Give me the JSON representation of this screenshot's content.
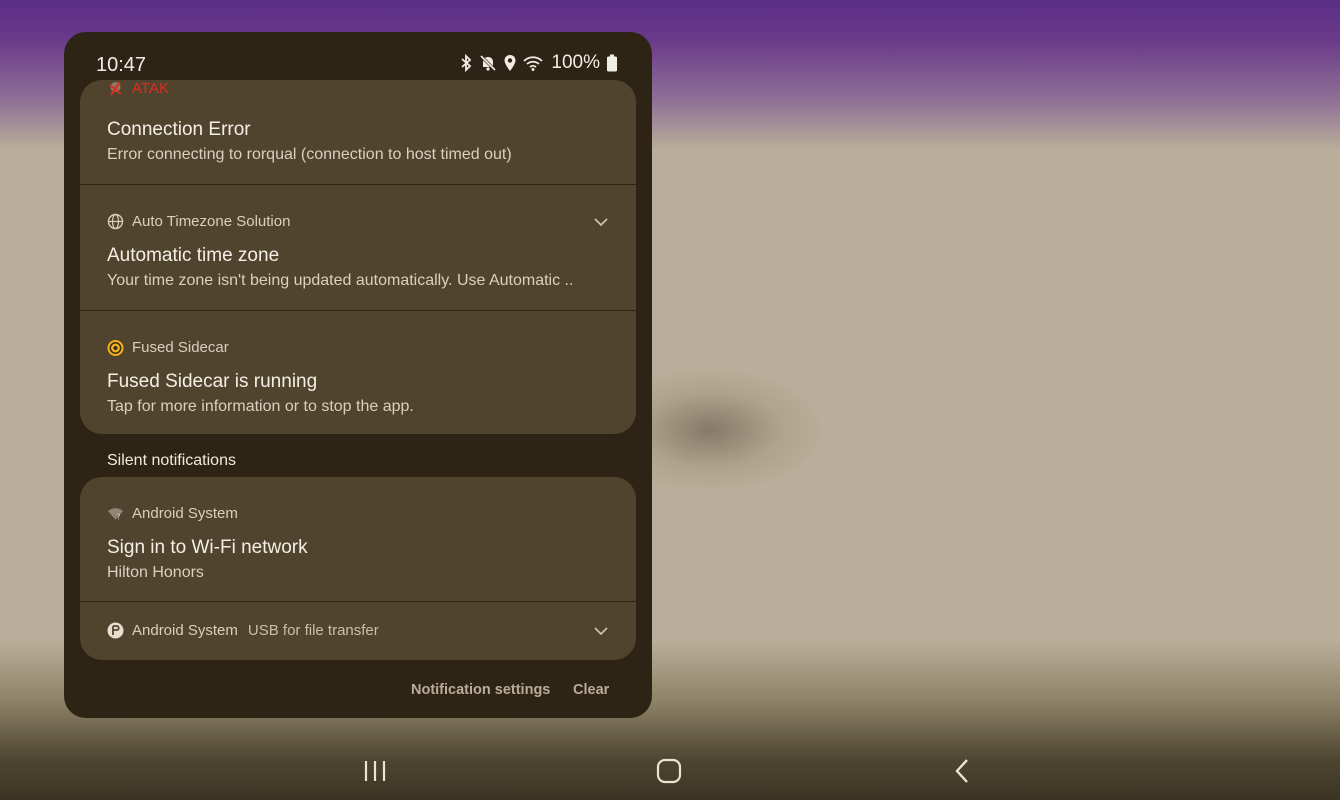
{
  "status_bar": {
    "time": "10:47",
    "battery": "100%",
    "icons": [
      "bluetooth-icon",
      "mute-icon",
      "location-icon",
      "wifi-icon",
      "battery-icon"
    ]
  },
  "notifications": [
    {
      "app": "ATAK",
      "app_color": "#e12b1e",
      "title": "Connection Error",
      "text": "Error connecting to rorqual (connection to host timed out)"
    },
    {
      "app": "Auto Timezone Solution",
      "title": "Automatic time zone",
      "text": "Your time zone isn't being updated automatically. Use Automatic .."
    },
    {
      "app": "Fused Sidecar",
      "title": "Fused Sidecar is running",
      "text": "Tap for more information or to stop the app."
    }
  ],
  "silent_section_label": "Silent notifications",
  "silent_notifications": [
    {
      "app": "Android System",
      "title": "Sign in to Wi-Fi network",
      "text": "Hilton Honors"
    },
    {
      "app": "Android System",
      "text": "USB for file transfer"
    }
  ],
  "footer": {
    "settings_label": "Notification settings",
    "clear_label": "Clear"
  },
  "nav": [
    "recents-icon",
    "home-icon",
    "back-icon"
  ],
  "colors": {
    "panel": "#2e2415",
    "card": "#51442f",
    "accent_error": "#e12b1e",
    "sidecar_icon": "#f2b21b"
  }
}
